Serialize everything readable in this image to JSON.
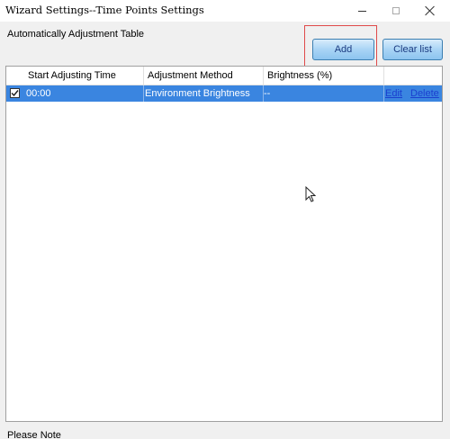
{
  "window": {
    "title": "Wizard Settings--Time Points Settings"
  },
  "table": {
    "title": "Automatically Adjustment Table",
    "columns": [
      "Start Adjusting Time",
      "Adjustment Method",
      "Brightness (%)"
    ],
    "rows": [
      {
        "checked": true,
        "time": "00:00",
        "method": "Environment Brightness",
        "brightness": "--",
        "edit_label": "Edit",
        "delete_label": "Delete"
      }
    ]
  },
  "buttons": {
    "add": "Add",
    "clear": "Clear list"
  },
  "footer": {
    "note": "Please Note"
  },
  "colors": {
    "selection": "#3a85e0",
    "highlight_box": "#e04a4a",
    "link": "#1b3fcf"
  }
}
